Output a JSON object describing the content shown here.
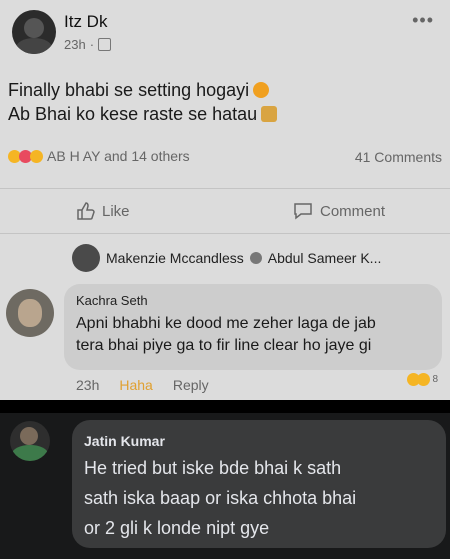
{
  "post": {
    "author": "Itz Dk",
    "time": "23h",
    "line1": "Finally bhabi se setting hogayi",
    "line2": "Ab Bhai ko kese raste se hatau",
    "reactors": "AB H AY and 14 others",
    "comments_count": "41 Comments",
    "like_label": "Like",
    "comment_label": "Comment"
  },
  "mention": {
    "name": "Makenzie Mccandless",
    "tag": "Abdul Sameer K..."
  },
  "comment": {
    "author": "Kachra Seth",
    "text1": "Apni bhabhi ke dood me zeher laga de jab",
    "text2": "tera bhai piye ga to fir line clear ho jaye gi",
    "time": "23h",
    "haha": "Haha",
    "reply": "Reply",
    "react_count": "8"
  },
  "reply_comment": {
    "author": "Jatin Kumar",
    "text1": "He tried but iske bde bhai k sath",
    "text2": "sath iska baap or iska chhota bhai",
    "text3": "or 2 gli k londe nipt gye"
  }
}
